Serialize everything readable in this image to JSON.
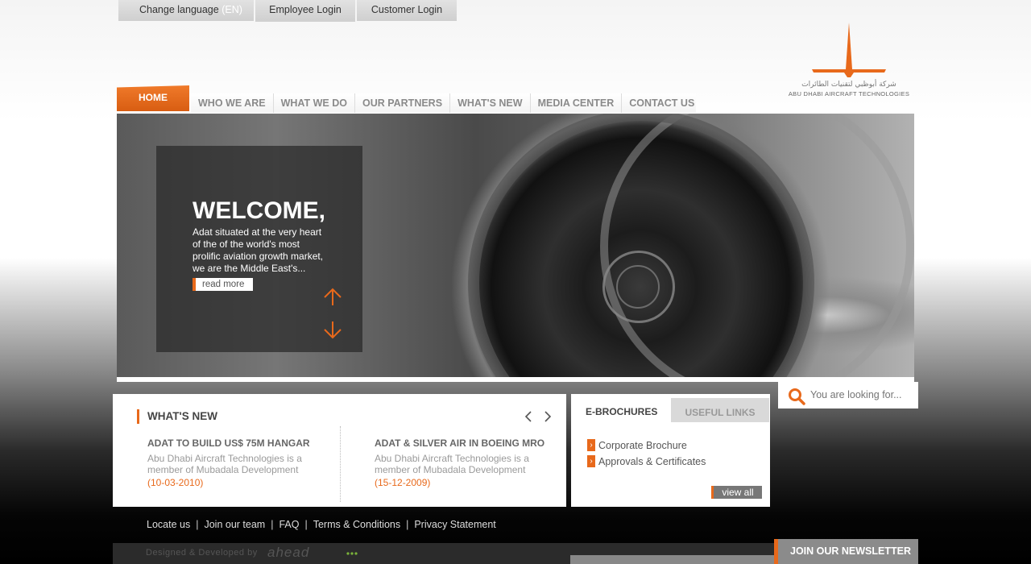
{
  "topbar": {
    "change_language": "Change language",
    "language_code": "(EN)",
    "employee_login": "Employee Login",
    "customer_login": "Customer Login"
  },
  "logo": {
    "arabic_name": "شركة أبوظبي لتقنيات الطائرات",
    "name": "ABU DHABI AIRCRAFT TECHNOLOGIES"
  },
  "nav": {
    "home": "HOME",
    "items": [
      "WHO WE ARE",
      "WHAT WE DO",
      "OUR PARTNERS",
      "WHAT'S NEW",
      "MEDIA CENTER",
      "CONTACT US"
    ]
  },
  "hero": {
    "title": "WELCOME,",
    "description": "Adat situated at the very heart of the of the world's most prolific aviation growth market, we are the Middle East's...",
    "read_more": "read more"
  },
  "search": {
    "placeholder": "You are looking for..."
  },
  "whats_new": {
    "heading": "WHAT'S NEW",
    "items": [
      {
        "title": "ADAT TO BUILD US$ 75M HANGAR",
        "body": "Abu Dhabi Aircraft Technologies is a member of Mubadala Development",
        "date": "(10-03-2010)"
      },
      {
        "title": "ADAT & SILVER AIR IN BOEING MRO",
        "body": "Abu Dhabi Aircraft Technologies is a member of Mubadala Development",
        "date": "(15-12-2009)"
      }
    ]
  },
  "brochures": {
    "tab_active": "E-BROCHURES",
    "tab_inactive": "USEFUL LINKS",
    "links": [
      "Corporate Brochure",
      "Approvals & Certificates"
    ],
    "view_all": "view all"
  },
  "footer": {
    "links": [
      "Locate us",
      "Join our team",
      "FAQ",
      "Terms & Conditions",
      "Privacy Statement"
    ],
    "separator": "|",
    "credit": "Designed & Developed by",
    "developer": "ahead",
    "newsletter": "JOIN OUR NEWSLETTER"
  },
  "colors": {
    "accent": "#e8691b",
    "nav_text": "#8a8a8a"
  }
}
